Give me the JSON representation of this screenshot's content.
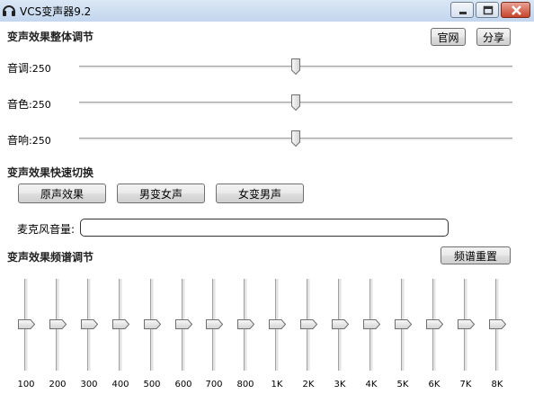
{
  "window": {
    "title": "VCS变声器9.2"
  },
  "header": {
    "section_title": "变声效果整体调节",
    "official_btn": "官网",
    "share_btn": "分享"
  },
  "sliders": [
    {
      "label": "音调",
      "value": "250",
      "level": 0.5
    },
    {
      "label": "音色",
      "value": "250",
      "level": 0.5
    },
    {
      "label": "音响",
      "value": "250",
      "level": 0.5
    }
  ],
  "quick_switch": {
    "title": "变声效果快速切换",
    "buttons": [
      "原声效果",
      "男变女声",
      "女变男声"
    ]
  },
  "mic": {
    "label": "麦克风音量:",
    "level": 0
  },
  "eq": {
    "title": "变声效果频谱调节",
    "reset_btn": "频谱重置",
    "bands": [
      {
        "label": "100",
        "level": 0.5
      },
      {
        "label": "200",
        "level": 0.5
      },
      {
        "label": "300",
        "level": 0.5
      },
      {
        "label": "400",
        "level": 0.5
      },
      {
        "label": "500",
        "level": 0.5
      },
      {
        "label": "600",
        "level": 0.5
      },
      {
        "label": "700",
        "level": 0.5
      },
      {
        "label": "800",
        "level": 0.5
      },
      {
        "label": "1K",
        "level": 0.5
      },
      {
        "label": "2K",
        "level": 0.5
      },
      {
        "label": "3K",
        "level": 0.5
      },
      {
        "label": "4K",
        "level": 0.5
      },
      {
        "label": "5K",
        "level": 0.5
      },
      {
        "label": "6K",
        "level": 0.5
      },
      {
        "label": "7K",
        "level": 0.5
      },
      {
        "label": "8K",
        "level": 0.5
      }
    ]
  }
}
